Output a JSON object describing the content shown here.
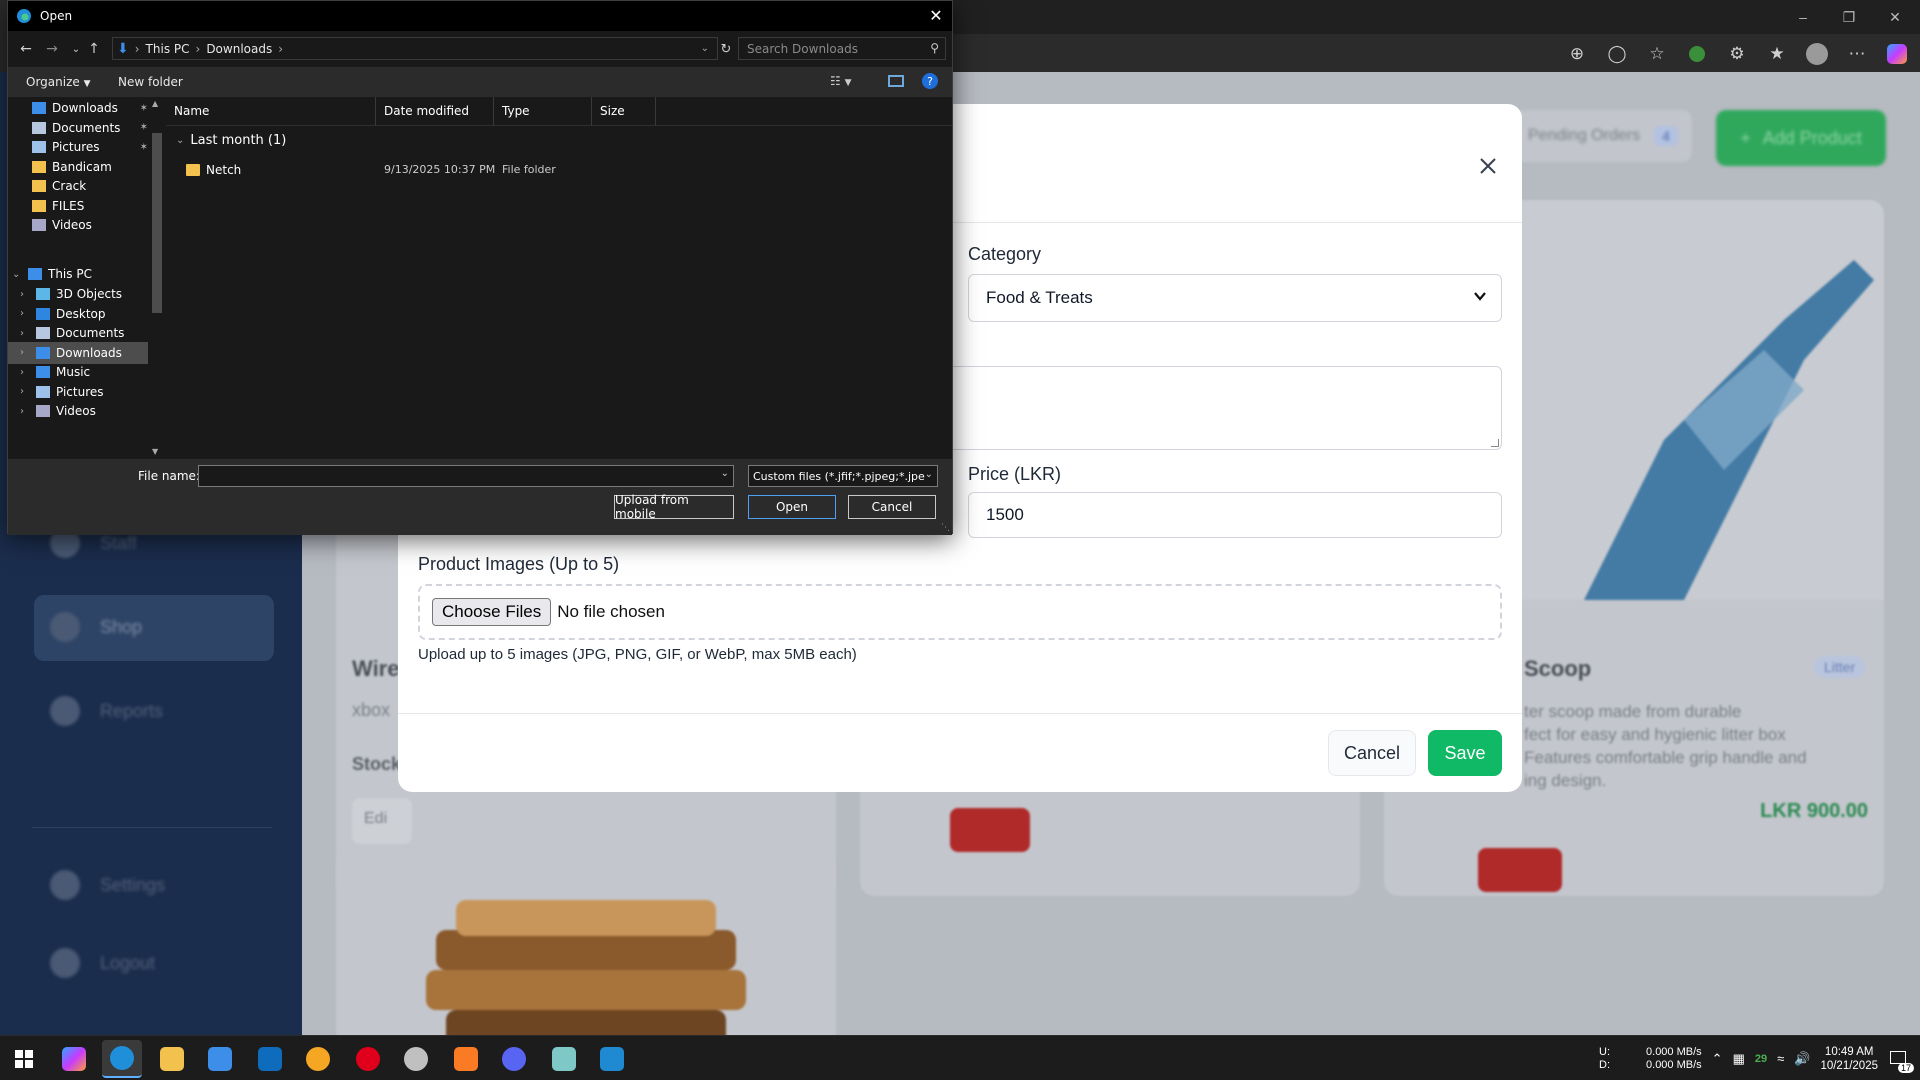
{
  "dialog": {
    "title": "Open",
    "breadcrumb": [
      "This PC",
      "Downloads"
    ],
    "search_placeholder": "Search Downloads",
    "organize_label": "Organize",
    "new_folder_label": "New folder",
    "tree_quick": [
      {
        "label": "Downloads",
        "icon": "download-icon",
        "pinned": true
      },
      {
        "label": "Documents",
        "icon": "document-icon",
        "pinned": true
      },
      {
        "label": "Pictures",
        "icon": "pictures-icon",
        "pinned": true
      },
      {
        "label": "Bandicam",
        "icon": "folder-icon",
        "pinned": false
      },
      {
        "label": "Crack",
        "icon": "folder-icon",
        "pinned": false
      },
      {
        "label": "FILES",
        "icon": "folder-icon",
        "pinned": false
      },
      {
        "label": "Videos",
        "icon": "video-icon",
        "pinned": false
      }
    ],
    "tree_pc_label": "This PC",
    "tree_pc": [
      {
        "label": "3D Objects",
        "icon": "3d-objects-icon"
      },
      {
        "label": "Desktop",
        "icon": "desktop-icon"
      },
      {
        "label": "Documents",
        "icon": "document-icon"
      },
      {
        "label": "Downloads",
        "icon": "download-icon",
        "selected": true
      },
      {
        "label": "Music",
        "icon": "music-icon"
      },
      {
        "label": "Pictures",
        "icon": "pictures-icon"
      },
      {
        "label": "Videos",
        "icon": "video-icon"
      }
    ],
    "columns": [
      "Name",
      "Date modified",
      "Type",
      "Size"
    ],
    "group_label": "Last month (1)",
    "files": [
      {
        "name": "Netch",
        "date": "9/13/2025 10:37 PM",
        "type": "File folder",
        "size": ""
      }
    ],
    "file_name_label": "File name:",
    "file_name_value": "",
    "filter_value": "Custom files (*.jfif;*.pjpeg;*.jpe",
    "upload_mobile_label": "Upload from mobile",
    "open_label": "Open",
    "cancel_label": "Cancel"
  },
  "modal": {
    "category_label": "Category",
    "category_value": "Food & Treats",
    "price_label": "Price (LKR)",
    "price_value": "1500",
    "images_label": "Product Images (Up to 5)",
    "choose_files_label": "Choose Files",
    "no_file_label": "No file chosen",
    "images_hint": "Upload up to 5 images (JPG, PNG, GIF, or WebP, max 5MB each)",
    "cancel_label": "Cancel",
    "save_label": "Save"
  },
  "background": {
    "pending_orders_label": "Pending Orders",
    "pending_orders_count": "4",
    "add_product_label": "Add Product",
    "sidebar": [
      "Staff",
      "Shop",
      "Reports",
      "Settings",
      "Logout"
    ],
    "card_title_left": "Wire",
    "card_sub_left": "xbox",
    "card_stock_label": "Stock",
    "card_edit_label": "Edi",
    "card_title_right": "Scoop",
    "card_badge_right": "Litter",
    "card_desc_right": "ter scoop made from durable\nfect for easy and hygienic litter box\nFeatures comfortable grip handle and\ning design.",
    "card_price_right": "LKR 900.00"
  },
  "taskbar": {
    "net_up_label": "U:",
    "net_down_label": "D:",
    "net_up": "0.000 MB/s",
    "net_down": "0.000 MB/s",
    "time": "10:49 AM",
    "date": "10/21/2025",
    "notif_count": "17",
    "temp": "29"
  },
  "colors": {
    "accent_green": "#10b965",
    "sidebar_bg": "#1b2d4d",
    "dialog_bg": "#191919",
    "selection": "#4d4d4d"
  }
}
